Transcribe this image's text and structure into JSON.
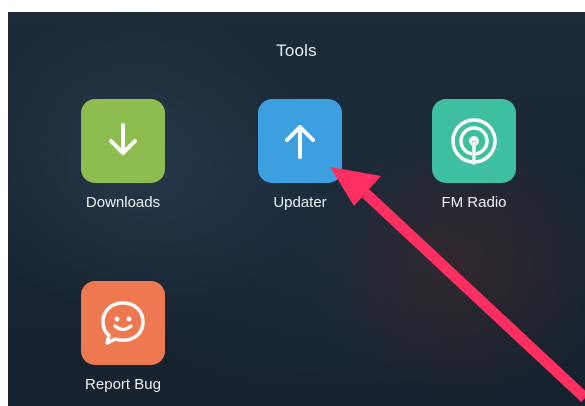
{
  "folder": {
    "title": "Tools"
  },
  "apps": [
    {
      "label": "Downloads",
      "icon": "download-arrow-icon",
      "color": "#8dbd4f"
    },
    {
      "label": "Updater",
      "icon": "up-arrow-icon",
      "color": "#3b9fe0"
    },
    {
      "label": "FM Radio",
      "icon": "radio-signal-icon",
      "color": "#3ec0a0"
    },
    {
      "label": "Report Bug",
      "icon": "smiley-chat-icon",
      "color": "#ee7850"
    }
  ],
  "annotation": {
    "icon": "pointer-arrow-icon",
    "color": "#ff2f62"
  }
}
